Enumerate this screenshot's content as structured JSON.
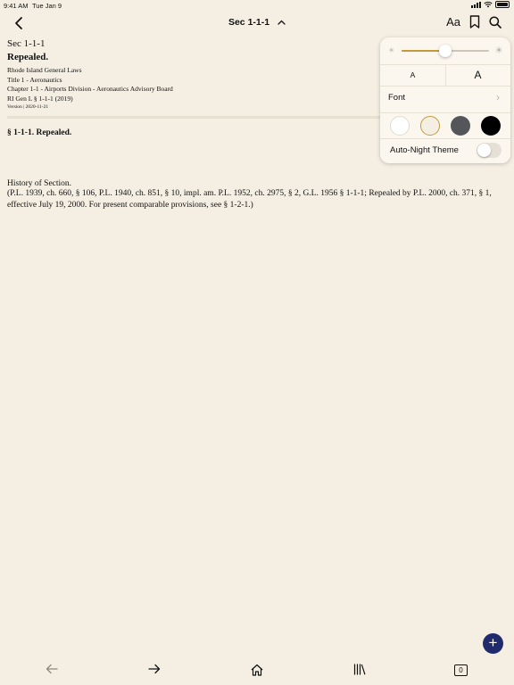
{
  "status_bar": {
    "time": "9:41 AM",
    "date": "Tue Jan 9"
  },
  "nav": {
    "title": "Sec 1-1-1",
    "title_chevron": "⌃",
    "font_settings_label": "Aa",
    "back_icon": "chevron-left-icon",
    "bookmark_icon": "bookmark-icon",
    "search_icon": "search-icon"
  },
  "document": {
    "section_code": "Sec 1-1-1",
    "heading": "Repealed.",
    "breadcrumb": [
      "Rhode Island General Laws",
      "Title 1 - Aeronautics",
      "Chapter 1-1 - Airports Division - Aeronautics Advisory Board",
      "RI Gen L § 1-1-1 (2019)"
    ],
    "version": "Version | 2020-11-21",
    "section_title": "§ 1-1-1. Repealed.",
    "history_label": "History of Section.",
    "history_text": "(P.L. 1939, ch. 660, § 106, P.L. 1940, ch. 851, § 10, impl. am. P.L. 1952, ch. 2975, § 2, G.L. 1956 § 1-1-1; Repealed by P.L. 2000, ch. 371, § 1, effective July 19, 2000. For present comparable provisions, see § 1-2-1.)"
  },
  "display_popover": {
    "brightness_level": 0.5,
    "font_size_small_label": "A",
    "font_size_large_label": "A",
    "font_label": "Font",
    "font_chevron": "›",
    "themes": [
      {
        "name": "white",
        "color": "#ffffff",
        "selected": false
      },
      {
        "name": "sepia",
        "color": "#f5efe3",
        "selected": true
      },
      {
        "name": "gray",
        "color": "#55565a",
        "selected": false
      },
      {
        "name": "black",
        "color": "#000000",
        "selected": false
      }
    ],
    "auto_night_label": "Auto-Night Theme",
    "auto_night_enabled": false
  },
  "fab": {
    "label": "+"
  },
  "toolbar": {
    "tab_count": "0",
    "items": [
      "back-arrow-icon",
      "forward-arrow-icon",
      "home-icon",
      "library-icon",
      "tabs-icon"
    ]
  },
  "colors": {
    "background": "#f5efe3",
    "accent": "#c29a3c",
    "fab": "#1f2b6d"
  }
}
